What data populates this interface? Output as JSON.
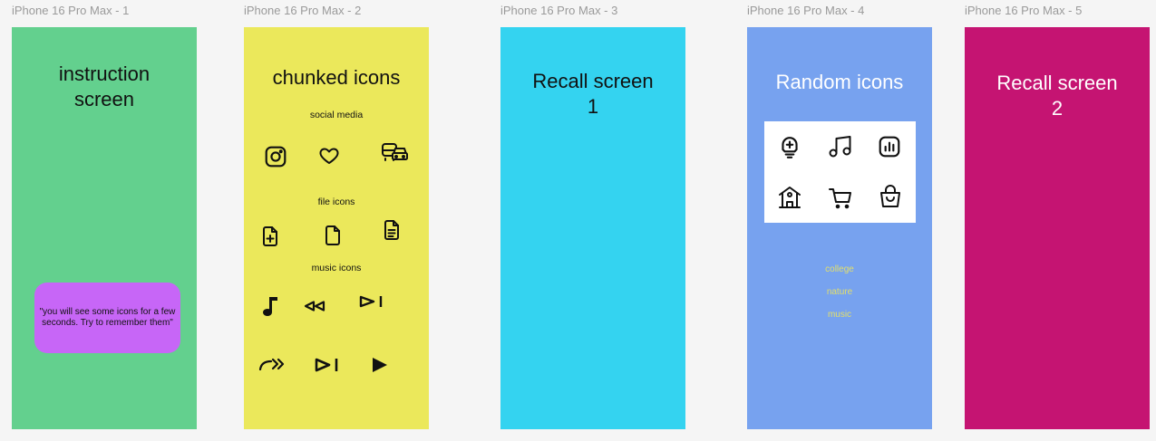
{
  "frames": [
    {
      "label": "iPhone 16 Pro Max - 1",
      "title_line1": "instruction",
      "title_line2": "screen",
      "message": "\"you will see some icons for a few seconds. Try to remember them\"",
      "bg": "#63d08e",
      "box_color": "#c766f7"
    },
    {
      "label": "iPhone 16 Pro Max - 2",
      "title": "chunked icons",
      "sections": {
        "social": {
          "label": "social media",
          "icons": [
            "instagram-icon",
            "heart-icon",
            "vehicles-icon"
          ]
        },
        "file": {
          "label": "file icons",
          "icons": [
            "file-plus-icon",
            "file-icon",
            "file-text-icon"
          ]
        },
        "music": {
          "label": "music icons",
          "icons": [
            "music-note-icon",
            "rewind-icon",
            "play-pause-icon",
            "fast-forward-icon",
            "skip-next-icon",
            "play-icon"
          ]
        }
      },
      "bg": "#ebe85b"
    },
    {
      "label": "iPhone 16 Pro Max - 3",
      "title_line1": "Recall screen",
      "title_line2": "1",
      "bg": "#34d3f0"
    },
    {
      "label": "iPhone 16 Pro Max - 4",
      "title": "Random icons",
      "icons": [
        "lightbulb-plus-icon",
        "music-notes-icon",
        "bar-chart-icon",
        "school-icon",
        "shopping-cart-icon",
        "shopping-bag-icon"
      ],
      "categories": [
        "college",
        "nature",
        "music"
      ],
      "bg": "#77a2ef",
      "category_color": "#e3df6a"
    },
    {
      "label": "iPhone 16 Pro Max - 5",
      "title_line1": "Recall screen",
      "title_line2": "2",
      "bg": "#c51472"
    }
  ]
}
